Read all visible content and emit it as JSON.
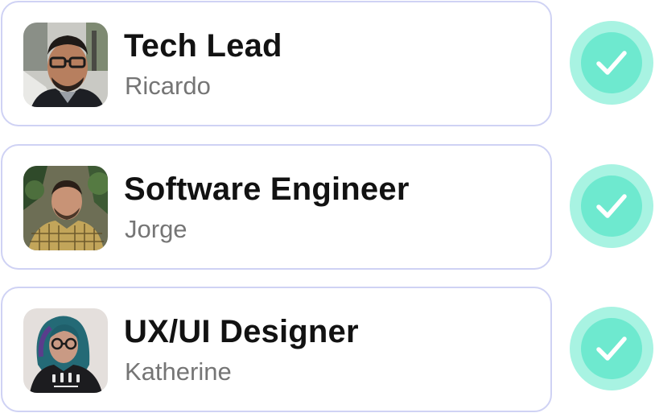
{
  "members": [
    {
      "role": "Tech Lead",
      "name": "Ricardo",
      "avatar_icon": "man-glasses-photo",
      "status_icon": "check-icon",
      "checked": true
    },
    {
      "role": "Software Engineer",
      "name": "Jorge",
      "avatar_icon": "man-plaid-shirt-photo",
      "status_icon": "check-icon",
      "checked": true
    },
    {
      "role": "UX/UI Designer",
      "name": "Katherine",
      "avatar_icon": "woman-blue-hair-photo",
      "status_icon": "check-icon",
      "checked": true
    }
  ],
  "colors": {
    "card_border": "#cfd2f4",
    "role_text": "#121212",
    "name_text": "#757575",
    "check_outer": "#a8f3e2",
    "check_inner": "#6ee9cf",
    "check_mark": "#ffffff"
  }
}
